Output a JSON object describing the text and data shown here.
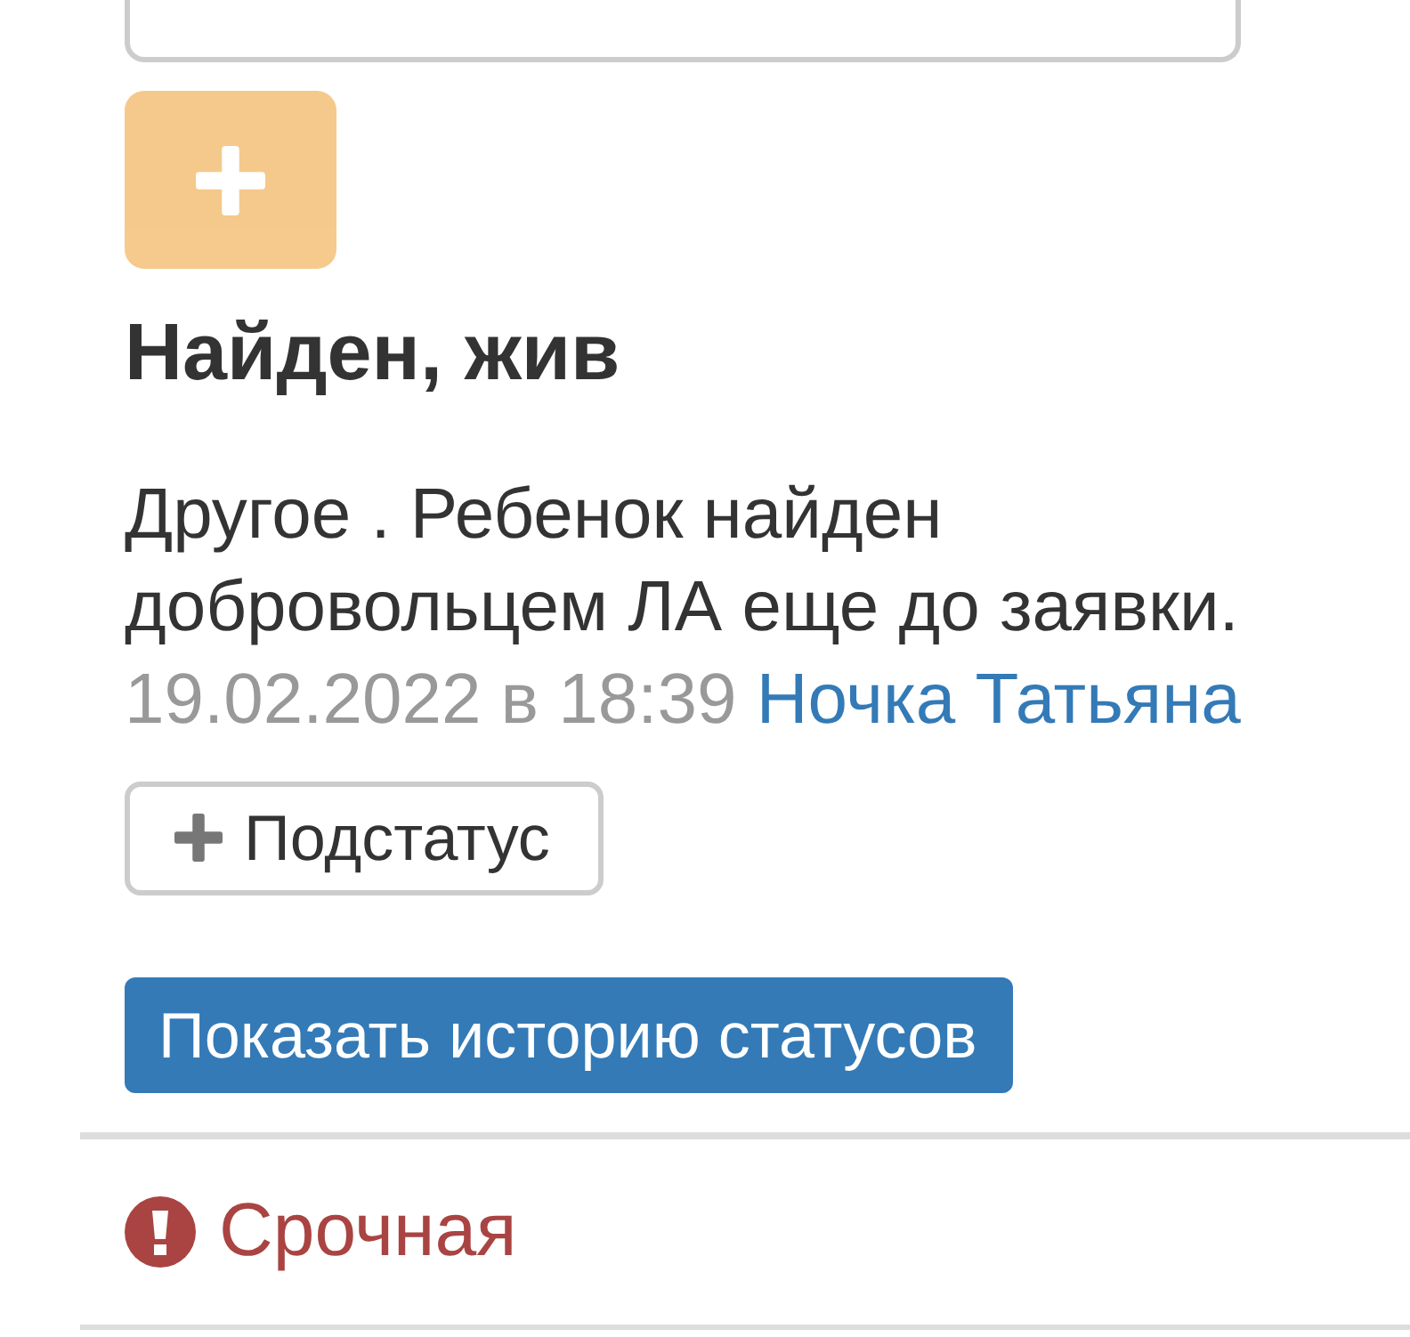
{
  "add_button": {
    "disabled": true
  },
  "status": {
    "title": "Найден, жив",
    "description": "Другое . Ребенок найден добровольцем ЛА еще до заявки.",
    "date": "19.02.2022 в 18:39",
    "author": "Ночка Татьяна"
  },
  "buttons": [
    {
      "kind": "substatus",
      "label": "Подстатус"
    },
    {
      "kind": "history",
      "label": "Показать историю статусов"
    }
  ],
  "priority": {
    "label": "Срочная"
  }
}
